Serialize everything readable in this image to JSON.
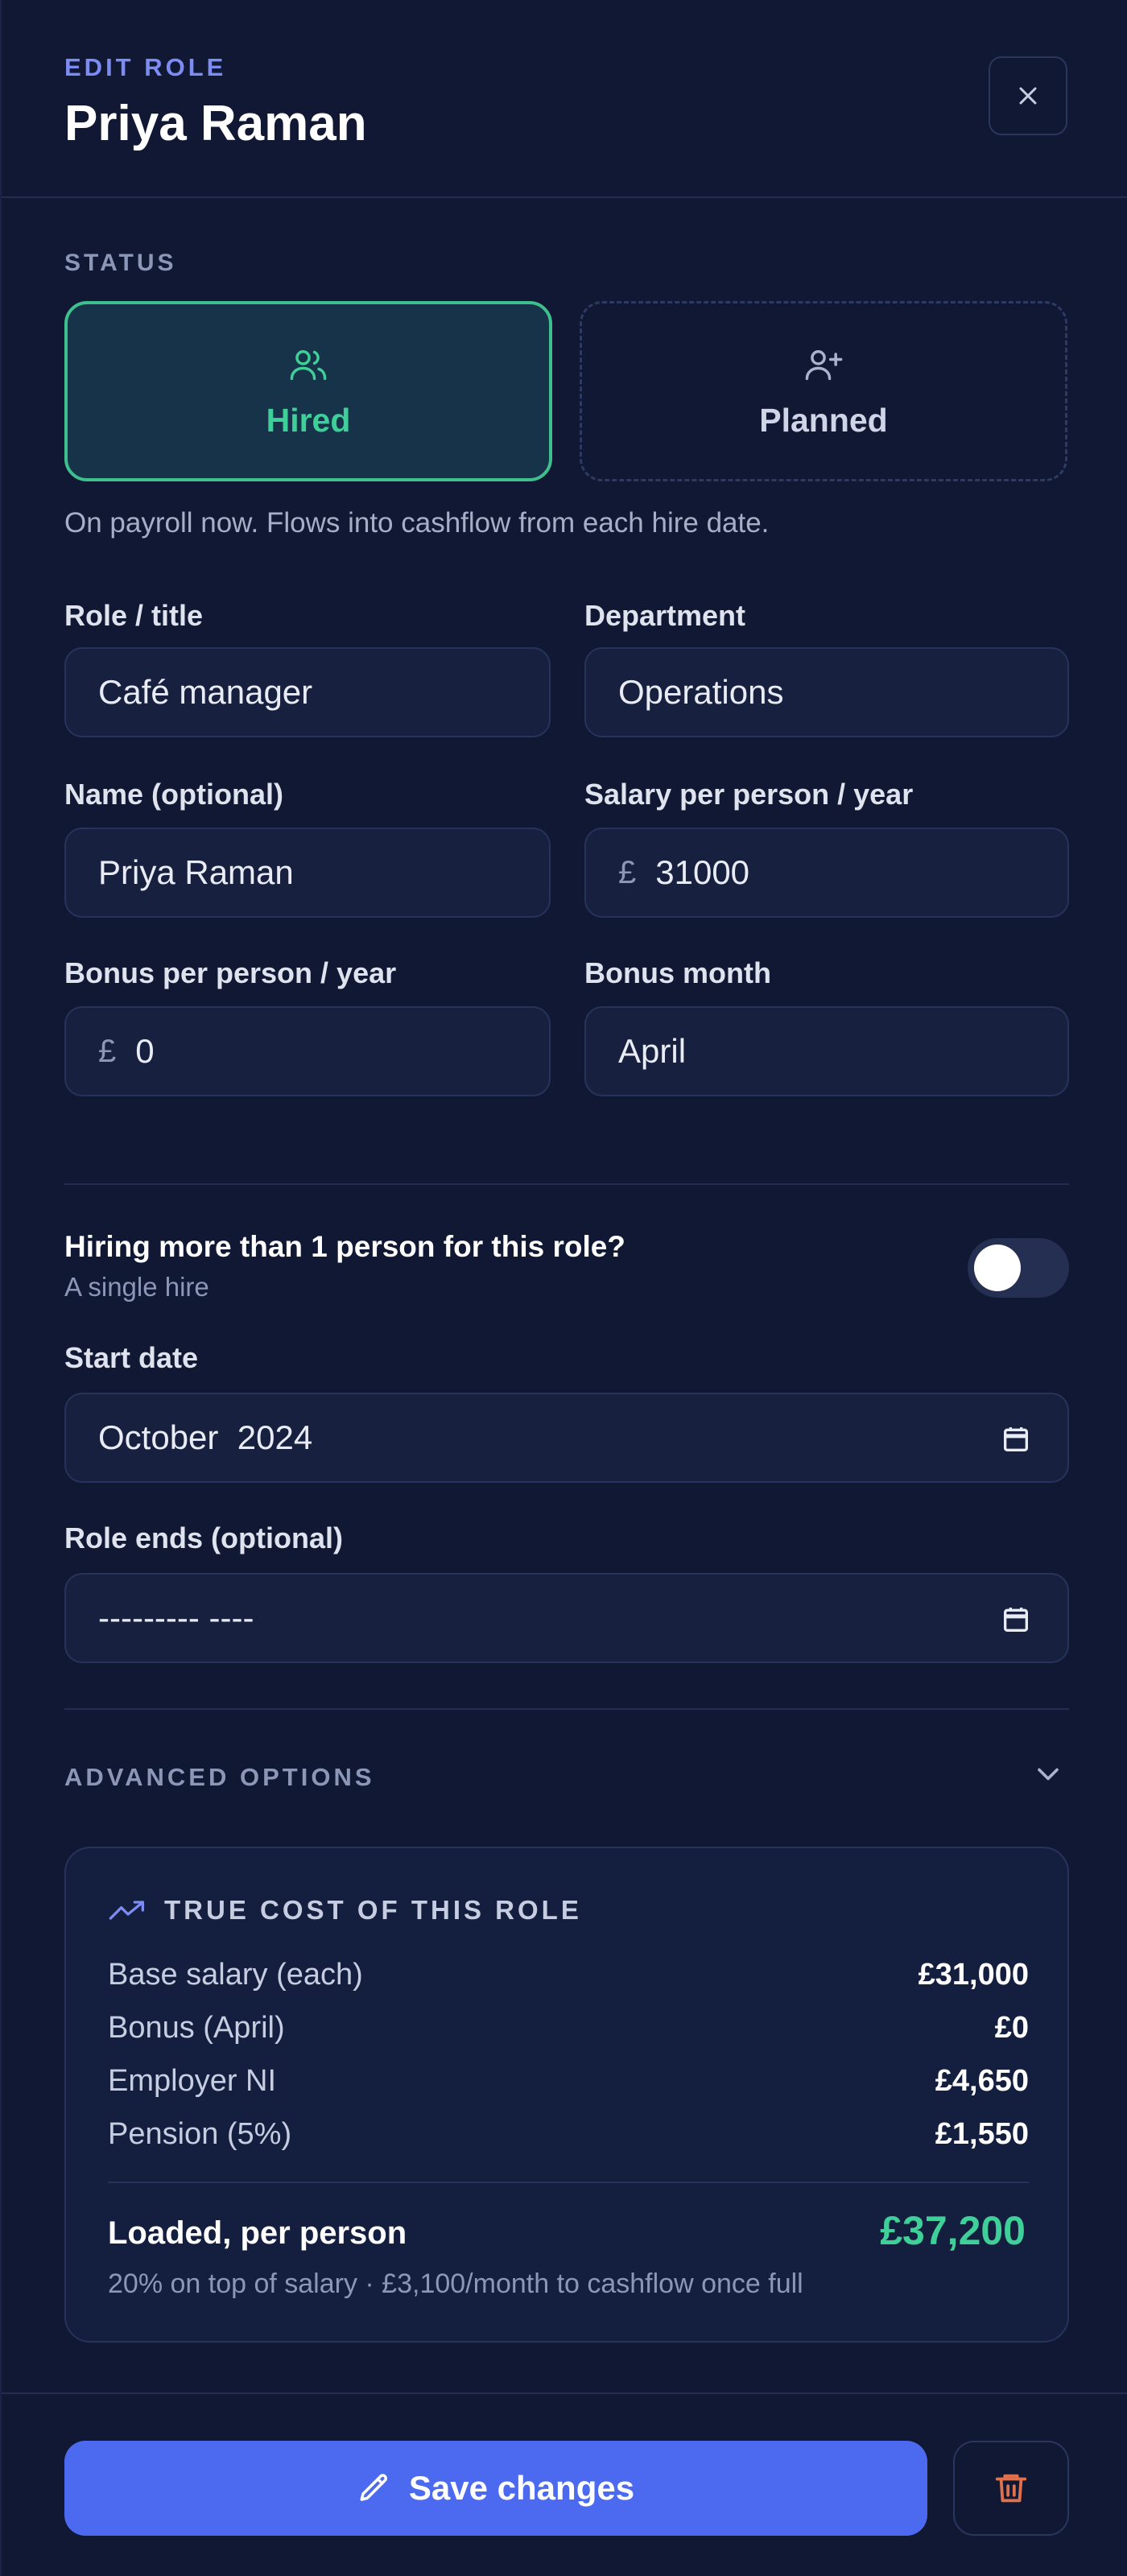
{
  "header": {
    "eyebrow": "EDIT ROLE",
    "title": "Priya Raman"
  },
  "status": {
    "label": "STATUS",
    "options": [
      {
        "label": "Hired",
        "icon": "users-icon",
        "selected": true
      },
      {
        "label": "Planned",
        "icon": "user-plus-icon",
        "selected": false
      }
    ],
    "hint": "On payroll now. Flows into cashflow from each hire date."
  },
  "fields": {
    "role": {
      "label": "Role / title",
      "value": "Café manager"
    },
    "department": {
      "label": "Department",
      "value": "Operations"
    },
    "name": {
      "label": "Name (optional)",
      "value": "Priya Raman"
    },
    "salary": {
      "label": "Salary per person / year",
      "currency": "£",
      "value": "31000"
    },
    "bonus": {
      "label": "Bonus per person / year",
      "currency": "£",
      "value": "0"
    },
    "bonus_month": {
      "label": "Bonus month",
      "value": "April"
    }
  },
  "multi_hire": {
    "title": "Hiring more than 1 person for this role?",
    "subtitle": "A single hire",
    "enabled": false
  },
  "start_date": {
    "label": "Start date",
    "value": "October  2024"
  },
  "end_date": {
    "label": "Role ends (optional)",
    "value": "--------- ----"
  },
  "advanced": {
    "label": "ADVANCED OPTIONS"
  },
  "cost": {
    "title": "TRUE COST OF THIS ROLE",
    "rows": [
      {
        "label": "Base salary (each)",
        "value": "£31,000"
      },
      {
        "label": "Bonus (April)",
        "value": "£0"
      },
      {
        "label": "Employer NI",
        "value": "£4,650"
      },
      {
        "label": "Pension (5%)",
        "value": "£1,550"
      }
    ],
    "loaded_label": "Loaded, per person",
    "loaded_value": "£37,200",
    "note": "20% on top of salary · £3,100/month to cashflow once full"
  },
  "footer": {
    "save_label": "Save changes"
  },
  "colors": {
    "accent": "#4c6af0",
    "success": "#3fcf98",
    "danger": "#e0714f"
  }
}
